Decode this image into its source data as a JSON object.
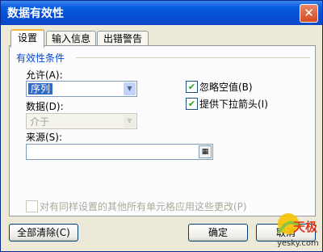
{
  "window": {
    "title": "数据有效性",
    "close_glyph": "✕"
  },
  "tabs": [
    {
      "label": "设置",
      "active": true
    },
    {
      "label": "输入信息",
      "active": false
    },
    {
      "label": "出错警告",
      "active": false
    }
  ],
  "group": {
    "title": "有效性条件"
  },
  "allow": {
    "label": "允许(A):",
    "value": "序列"
  },
  "data": {
    "label": "数据(D):",
    "value": "介于",
    "disabled": true
  },
  "ignore_blank": {
    "label": "忽略空值(B)",
    "checked": true
  },
  "dropdown": {
    "label": "提供下拉箭头(I)",
    "checked": true
  },
  "source": {
    "label": "来源(S):",
    "value": ""
  },
  "apply_all": {
    "label": "对有同样设置的其他所有单元格应用这些更改(P)",
    "checked": false,
    "disabled": true
  },
  "buttons": {
    "clear_all": "全部清除(C)",
    "ok": "确定",
    "cancel": "取消"
  },
  "watermark": {
    "text": "天极",
    "site": "yesky.com"
  },
  "colors": {
    "titlebar": "#0a5fe0",
    "group_title": "#0046d5",
    "selection": "#316ac5",
    "check": "#21a121"
  }
}
